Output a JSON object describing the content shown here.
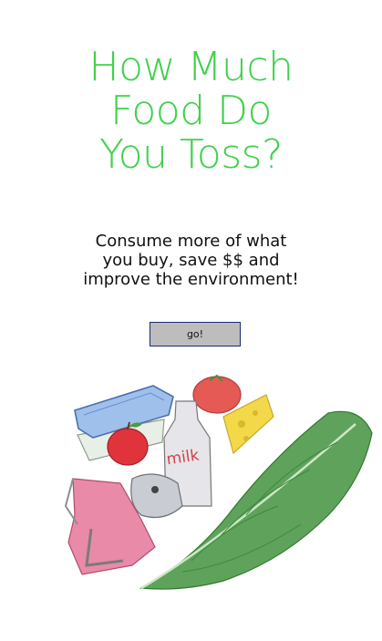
{
  "title_lines": [
    "How Much",
    "Food Do",
    "You Toss?"
  ],
  "subtitle_lines": [
    "Consume more of what",
    "you buy, save $$ and",
    "improve the environment!"
  ],
  "go_button": {
    "label": "go!"
  },
  "illustration": {
    "milk_label": "milk"
  },
  "colors": {
    "title": "#3fd14a",
    "button_bg": "#bdbdbd",
    "button_border": "#1c2a6e"
  }
}
